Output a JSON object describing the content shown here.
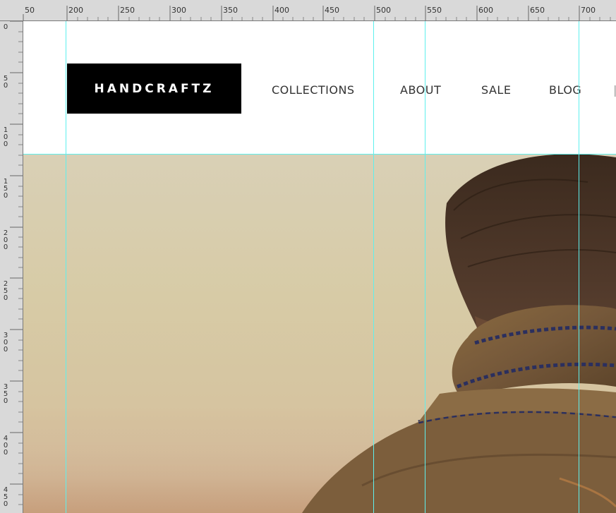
{
  "ruler": {
    "top_labels": [
      "50",
      "200",
      "250",
      "300",
      "350",
      "400",
      "450",
      "500",
      "550",
      "600",
      "650",
      "700"
    ],
    "left_labels": [
      "0",
      "50",
      "100",
      "150",
      "200",
      "250",
      "300",
      "350",
      "400",
      "450"
    ]
  },
  "site": {
    "logo": "HANDCRAFTZ",
    "nav": [
      "COLLECTIONS",
      "ABOUT",
      "SALE",
      "BLOG"
    ]
  },
  "colors": {
    "guide": "#5ef0ee",
    "logo_bg": "#000000",
    "nav_text": "#333333"
  }
}
